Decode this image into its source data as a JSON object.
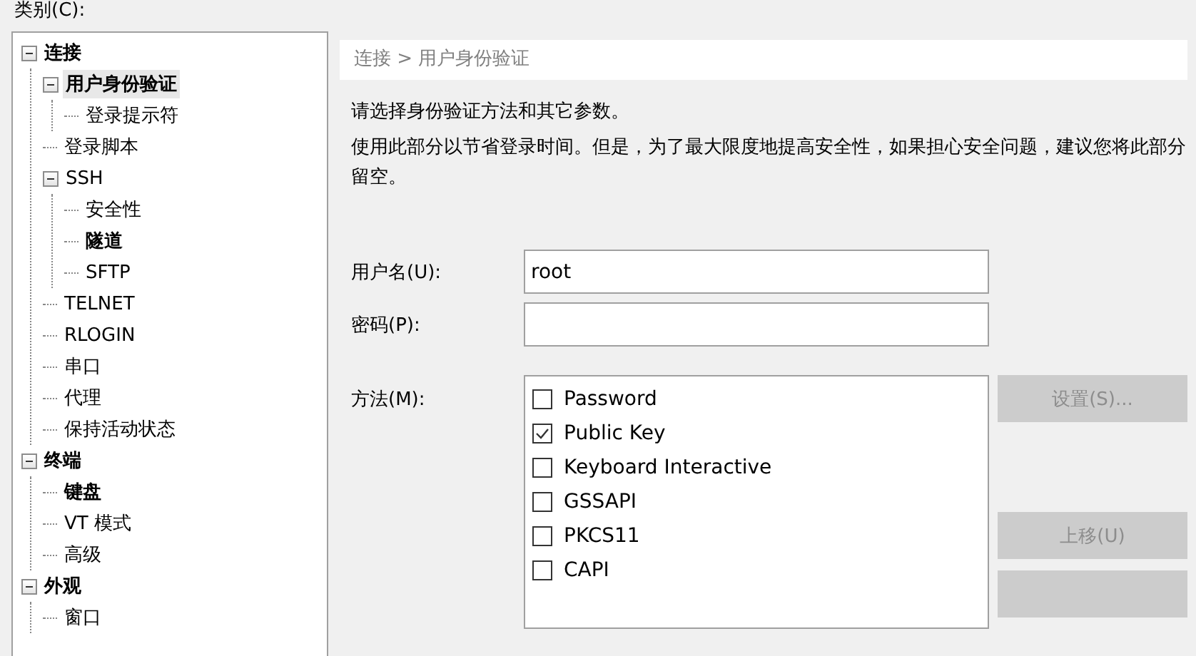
{
  "category_label": "类别(C):",
  "tree": [
    {
      "label": "连接",
      "bold": true,
      "selected": false,
      "expanded": true,
      "children": [
        {
          "label": "用户身份验证",
          "bold": true,
          "selected": true,
          "expanded": true,
          "children": [
            {
              "label": "登录提示符",
              "bold": false,
              "selected": false
            }
          ]
        },
        {
          "label": "登录脚本",
          "bold": false,
          "selected": false
        },
        {
          "label": "SSH",
          "bold": false,
          "selected": false,
          "expanded": true,
          "children": [
            {
              "label": "安全性",
              "bold": false,
              "selected": false
            },
            {
              "label": "隧道",
              "bold": true,
              "selected": false
            },
            {
              "label": "SFTP",
              "bold": false,
              "selected": false
            }
          ]
        },
        {
          "label": "TELNET",
          "bold": false,
          "selected": false
        },
        {
          "label": "RLOGIN",
          "bold": false,
          "selected": false
        },
        {
          "label": "串口",
          "bold": false,
          "selected": false
        },
        {
          "label": "代理",
          "bold": false,
          "selected": false
        },
        {
          "label": "保持活动状态",
          "bold": false,
          "selected": false
        }
      ]
    },
    {
      "label": "终端",
      "bold": true,
      "selected": false,
      "expanded": true,
      "children": [
        {
          "label": "键盘",
          "bold": true,
          "selected": false
        },
        {
          "label": "VT 模式",
          "bold": false,
          "selected": false
        },
        {
          "label": "高级",
          "bold": false,
          "selected": false
        }
      ]
    },
    {
      "label": "外观",
      "bold": true,
      "selected": false,
      "expanded": true,
      "children": [
        {
          "label": "窗口",
          "bold": false,
          "selected": false
        }
      ]
    }
  ],
  "breadcrumb": "连接 > 用户身份验证",
  "intro": "请选择身份验证方法和其它参数。",
  "description": "使用此部分以节省登录时间。但是，为了最大限度地提高安全性，如果担心安全问题，建议您将此部分留空。",
  "username": {
    "label": "用户名(U):",
    "value": "root"
  },
  "password": {
    "label": "密码(P):"
  },
  "method": {
    "label": "方法(M):",
    "options": [
      {
        "label": "Password",
        "checked": false
      },
      {
        "label": "Public Key",
        "checked": true
      },
      {
        "label": "Keyboard Interactive",
        "checked": false
      },
      {
        "label": "GSSAPI",
        "checked": false
      },
      {
        "label": "PKCS11",
        "checked": false
      },
      {
        "label": "CAPI",
        "checked": false
      }
    ]
  },
  "buttons": [
    {
      "label": "设置(S)...",
      "disabled": true,
      "kind": "top"
    },
    {
      "label": "上移(U)",
      "disabled": true,
      "kind": "bottom"
    },
    {
      "disabled": true,
      "kind": "bottom"
    }
  ]
}
